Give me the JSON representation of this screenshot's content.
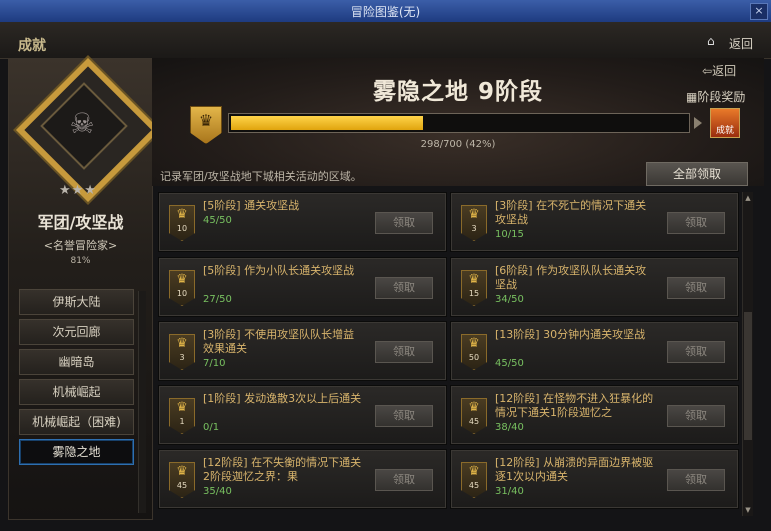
{
  "window": {
    "title": "冒险图鉴(无)",
    "close": "×"
  },
  "header": {
    "section": "成就",
    "home_icon": "home-icon",
    "back": "返回"
  },
  "left": {
    "category": "军团/攻坚战",
    "subtitle": "<名誉冒险家>",
    "percent": "81%",
    "stars": "★★★",
    "menu": [
      {
        "label": "伊斯大陆",
        "active": false
      },
      {
        "label": "次元回廊",
        "active": false
      },
      {
        "label": "幽暗岛",
        "active": false
      },
      {
        "label": "机械崛起",
        "active": false
      },
      {
        "label": "机械崛起（困难)",
        "active": false
      },
      {
        "label": "雾隐之地",
        "active": true
      }
    ]
  },
  "main": {
    "back": "返回",
    "stage_reward": "阶段奖励",
    "area_title": "雾隐之地  9阶段",
    "progress": {
      "current": 298,
      "total": 700,
      "fraction": 0.42,
      "text": "298/700 (42%)"
    },
    "reward_icon_label": "成就",
    "description": "记录军团/攻坚战地下城相关活动的区域。",
    "claim_all": "全部领取",
    "claim": "领取",
    "cards": [
      {
        "stage": "10",
        "title": "[5阶段] 通关攻坚战",
        "count": "45/50"
      },
      {
        "stage": "3",
        "title": "[3阶段] 在不死亡的情况下通关攻坚战",
        "count": "10/15"
      },
      {
        "stage": "10",
        "title": "[5阶段] 作为小队长通关攻坚战",
        "count": "27/50"
      },
      {
        "stage": "15",
        "title": "[6阶段] 作为攻坚队队长通关攻坚战",
        "count": "34/50"
      },
      {
        "stage": "3",
        "title": "[3阶段] 不使用攻坚队队长增益效果通关",
        "count": "7/10"
      },
      {
        "stage": "50",
        "title": "[13阶段] 30分钟内通关攻坚战",
        "count": "45/50"
      },
      {
        "stage": "1",
        "title": "[1阶段] 发动逸散3次以上后通关",
        "count": "0/1"
      },
      {
        "stage": "45",
        "title": "[12阶段] 在怪物不进入狂暴化的情况下通关1阶段迦忆之",
        "count": "38/40"
      },
      {
        "stage": "45",
        "title": "[12阶段] 在不失衡的情况下通关2阶段迦忆之界：果",
        "count": "35/40"
      },
      {
        "stage": "45",
        "title": "[12阶段] 从崩溃的异面边界被驱逐1次以内通关",
        "count": "31/40"
      }
    ]
  },
  "colors": {
    "accent": "#f0b419",
    "title_bg": "#2a4a94",
    "card_title": "#d8b46c",
    "count": "#78c060"
  }
}
